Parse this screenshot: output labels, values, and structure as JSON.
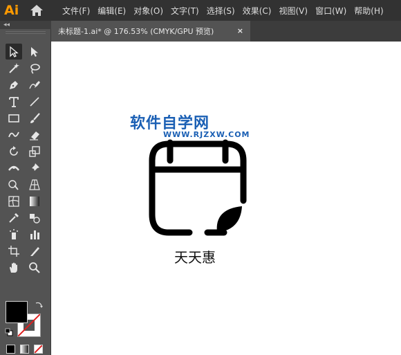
{
  "app": {
    "logo_text": "Ai"
  },
  "menu": {
    "items": [
      "文件(F)",
      "编辑(E)",
      "对象(O)",
      "文字(T)",
      "选择(S)",
      "效果(C)",
      "视图(V)",
      "窗口(W)",
      "帮助(H)"
    ]
  },
  "toolbar": {
    "collapse_glyph": "◂◂",
    "tools": [
      "selection-tool",
      "direct-selection-tool",
      "magic-wand-tool",
      "lasso-tool",
      "pen-tool",
      "curvature-tool",
      "type-tool",
      "line-segment-tool",
      "rectangle-tool",
      "paintbrush-tool",
      "shaper-tool",
      "eraser-tool",
      "rotate-tool",
      "scale-tool",
      "width-tool",
      "puppet-warp-tool",
      "shape-builder-tool",
      "perspective-grid-tool",
      "mesh-tool",
      "gradient-tool",
      "eyedropper-tool",
      "blend-tool",
      "symbol-sprayer-tool",
      "column-graph-tool",
      "artboard-tool",
      "slice-tool",
      "hand-tool",
      "zoom-tool"
    ],
    "fill_color": "#000000",
    "stroke_color": "#ffffff"
  },
  "document": {
    "tab_label": "未标题-1.ai* @ 176.53% (CMYK/GPU 预览)",
    "close_glyph": "×"
  },
  "canvas": {
    "watermark_title": "软件自学网",
    "watermark_url": "WWW.RJZXW.COM",
    "caption": "天天惠"
  },
  "colors": {
    "accent_logo": "#ff9a00",
    "watermark": "#1a5fb4",
    "menubar": "#323232",
    "panel": "#535353"
  }
}
